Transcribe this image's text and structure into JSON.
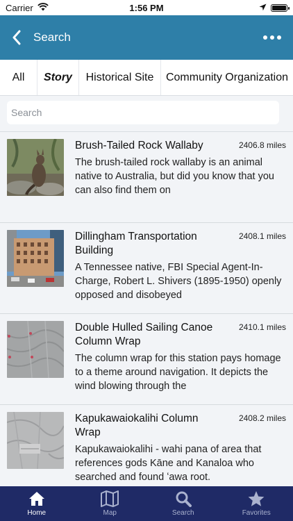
{
  "status_bar": {
    "carrier": "Carrier",
    "time": "1:56 PM"
  },
  "nav": {
    "title": "Search"
  },
  "tabs": [
    {
      "label": "All",
      "active": false
    },
    {
      "label": "Story",
      "active": true
    },
    {
      "label": "Historical Site",
      "active": false
    },
    {
      "label": "Community Organization",
      "active": false
    }
  ],
  "search": {
    "placeholder": "Search",
    "value": ""
  },
  "results": [
    {
      "title": "Brush-Tailed Rock Wallaby",
      "distance": "2406.8 miles",
      "description": "The brush-tailed rock wallaby is an animal native to Australia, but did you know that you can also find them on"
    },
    {
      "title": "Dillingham Transportation Building",
      "distance": "2408.1 miles",
      "description": "A Tennessee native, FBI Special Agent-In-Charge, Robert L. Shivers (1895-1950) openly opposed and disobeyed"
    },
    {
      "title": "Double Hulled Sailing Canoe Column Wrap",
      "distance": "2410.1 miles",
      "description": "The column wrap for this station pays homage to a theme around navigation. It depicts the wind blowing through the"
    },
    {
      "title": "Kapukawaiokalihi Column Wrap",
      "distance": "2408.2 miles",
      "description": "Kapukawaiokalihi - wahi pana of area that references gods Kāne and Kanaloa who searched and found ʻawa root."
    }
  ],
  "tab_bar": [
    {
      "label": "Home",
      "icon": "home-icon",
      "active": true
    },
    {
      "label": "Map",
      "icon": "map-icon",
      "active": false
    },
    {
      "label": "Search",
      "icon": "search-icon",
      "active": false
    },
    {
      "label": "Favorites",
      "icon": "star-icon",
      "active": false
    }
  ],
  "colors": {
    "nav": "#2e7fa8",
    "tab_bar": "#1f2a66",
    "background": "#f2f4f7"
  }
}
